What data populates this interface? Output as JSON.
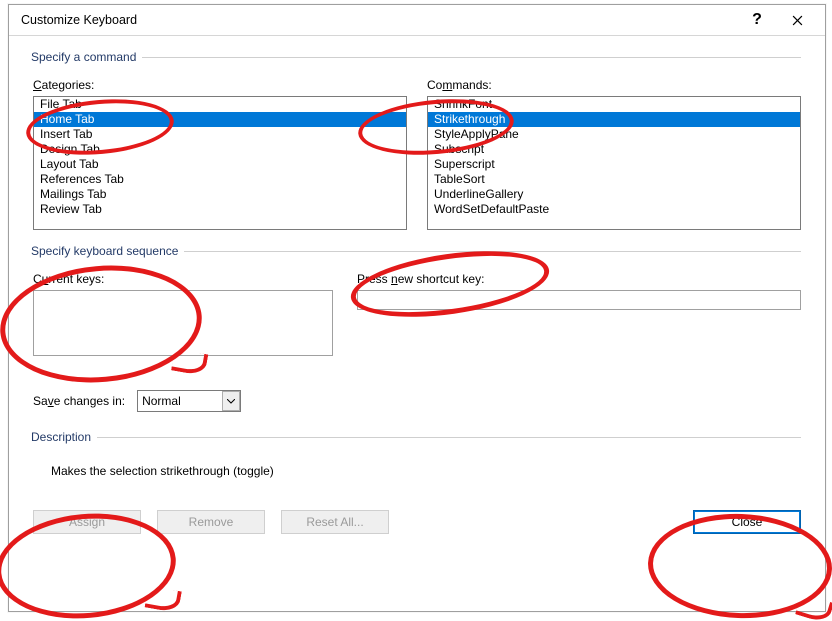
{
  "window": {
    "title": "Customize Keyboard"
  },
  "sections": {
    "specify_command": "Specify a command",
    "specify_sequence": "Specify keyboard sequence",
    "description": "Description"
  },
  "labels": {
    "categories_pre": "C",
    "categories_post": "ategories:",
    "commands_pre": "Co",
    "commands_und": "m",
    "commands_post": "mands:",
    "current_pre": "C",
    "current_und": "u",
    "current_post": "rrent keys:",
    "press_pre": "Press ",
    "press_und": "n",
    "press_post": "ew shortcut key:",
    "save_pre": "Sa",
    "save_und": "v",
    "save_post": "e changes in:"
  },
  "categories": {
    "items": [
      "File Tab",
      "Home Tab",
      "Insert Tab",
      "Design Tab",
      "Layout Tab",
      "References Tab",
      "Mailings Tab",
      "Review Tab"
    ],
    "selected_index": 1
  },
  "commands": {
    "items": [
      "ShrinkFont",
      "Strikethrough",
      "StyleApplyPane",
      "Subscript",
      "Superscript",
      "TableSort",
      "UnderlineGallery",
      "WordSetDefaultPaste"
    ],
    "selected_index": 1
  },
  "save_changes_in": {
    "value": "Normal"
  },
  "description_text": "Makes the selection strikethrough (toggle)",
  "buttons": {
    "assign": "Assign",
    "remove": "Remove",
    "reset": "Reset All...",
    "close": "Close"
  }
}
